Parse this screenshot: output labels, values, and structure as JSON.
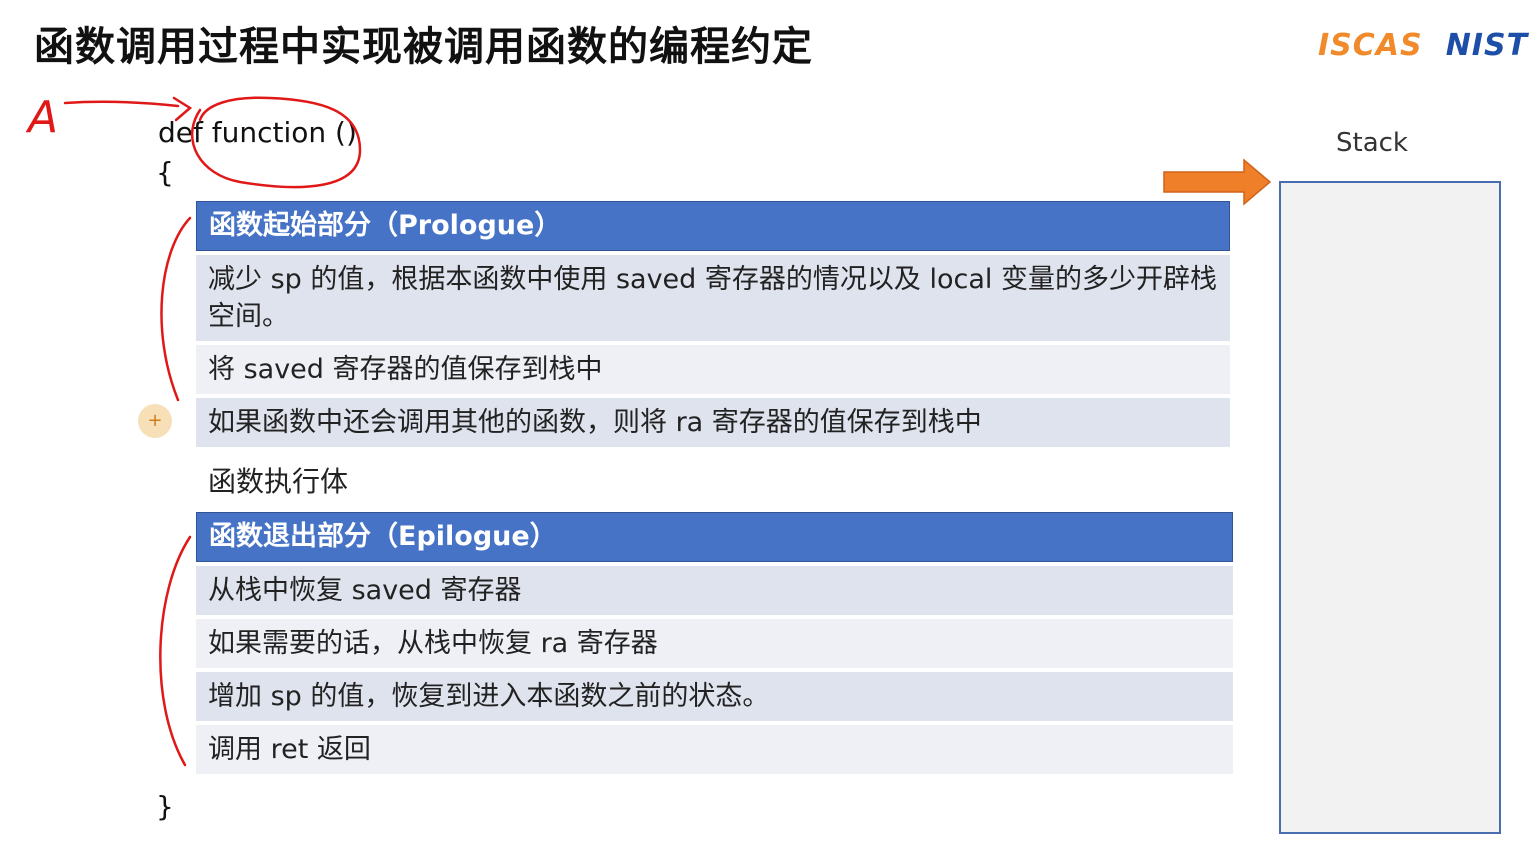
{
  "title": "函数调用过程中实现被调用函数的编程约定",
  "logos": {
    "iscas": "ISCAS",
    "nist": "NIST"
  },
  "code": {
    "signature": "def function ()",
    "open_brace": "{",
    "close_brace": "}"
  },
  "annotation": {
    "handwritten_letter": "A"
  },
  "prologue": {
    "header": "函数起始部分（Prologue）",
    "rows": [
      "减少 sp 的值，根据本函数中使用 saved 寄存器的情况以及 local 变量的多少开辟栈空间。",
      "将 saved 寄存器的值保存到栈中",
      "如果函数中还会调用其他的函数，则将 ra 寄存器的值保存到栈中"
    ]
  },
  "function_body": "函数执行体",
  "epilogue": {
    "header": "函数退出部分（Epilogue）",
    "rows": [
      "从栈中恢复 saved 寄存器",
      "如果需要的话，从栈中恢复 ra 寄存器",
      "增加 sp 的值，恢复到进入本函数之前的状态。",
      "调用 ret 返回"
    ]
  },
  "stack": {
    "label": "Stack"
  },
  "colors": {
    "header": "#4673c6",
    "row": "#dfe3ee",
    "row_alt": "#eef0f6",
    "arrow": "#f07f2a",
    "ink": "#e01818"
  }
}
